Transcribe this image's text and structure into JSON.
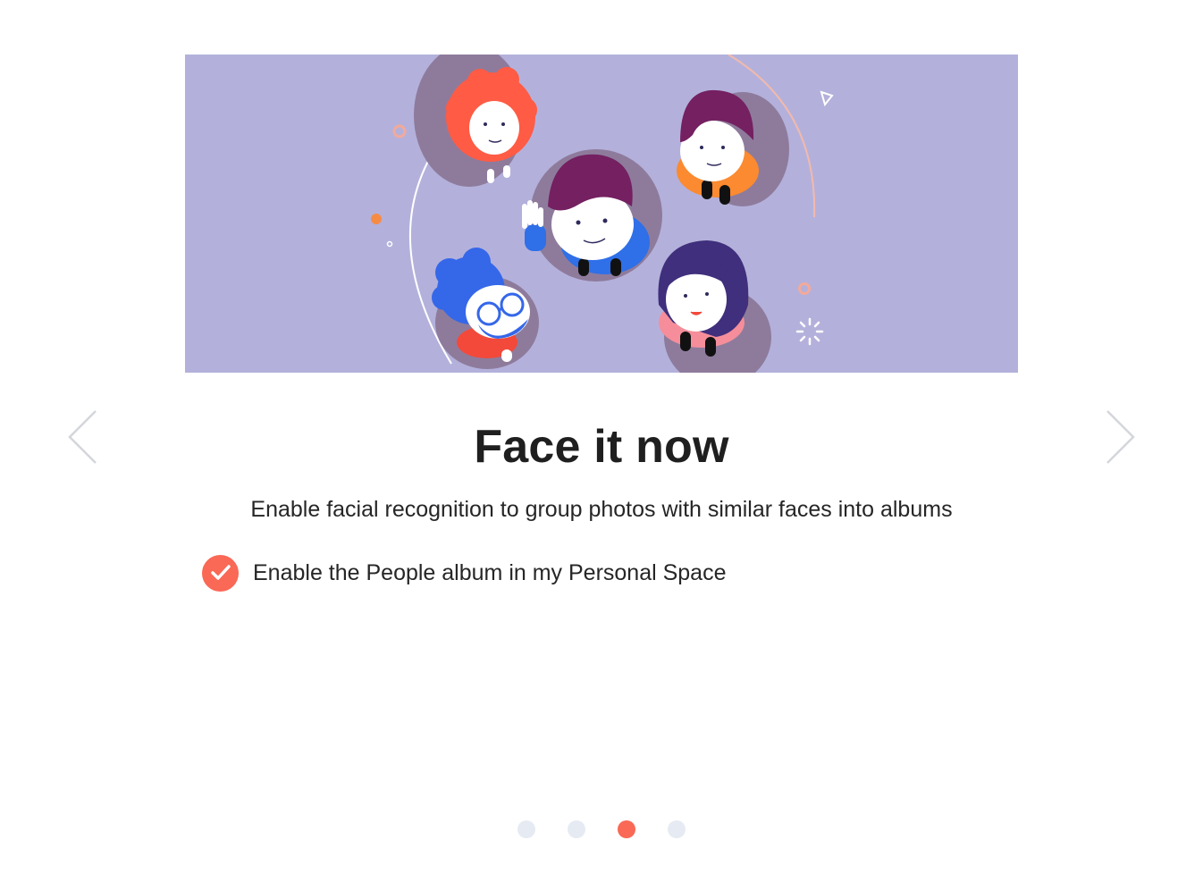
{
  "slide": {
    "title": "Face it now",
    "description": "Enable facial recognition to group photos with similar faces into albums",
    "option_label": "Enable the People album in my Personal Space",
    "option_checked": true
  },
  "navigation": {
    "prev_icon": "chevron-left-icon",
    "next_icon": "chevron-right-icon"
  },
  "pagination": {
    "total": 4,
    "active_index": 2
  },
  "colors": {
    "accent": "#fa6856",
    "banner_bg": "#b3b1db",
    "dot_inactive": "#e6ebf3",
    "text": "#1f1f1f"
  }
}
